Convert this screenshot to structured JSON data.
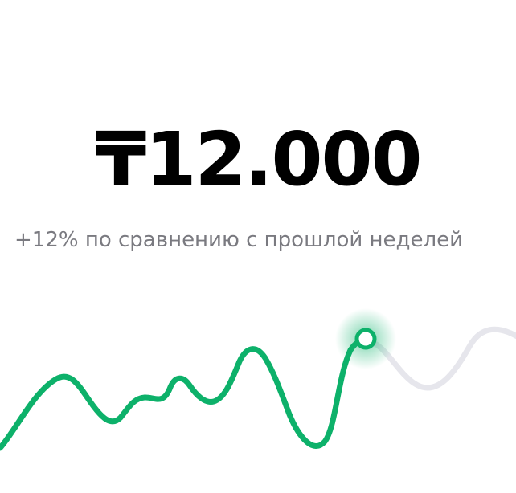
{
  "summary": {
    "amount": "₸12.000",
    "comparison": "+12% по сравнению с прошлой неделей"
  },
  "colors": {
    "accent": "#0db16a",
    "muted_line": "#e6e6ec",
    "text_primary": "#000000",
    "text_secondary": "#7a7a80"
  },
  "sparkline": {
    "active_index": 10
  }
}
